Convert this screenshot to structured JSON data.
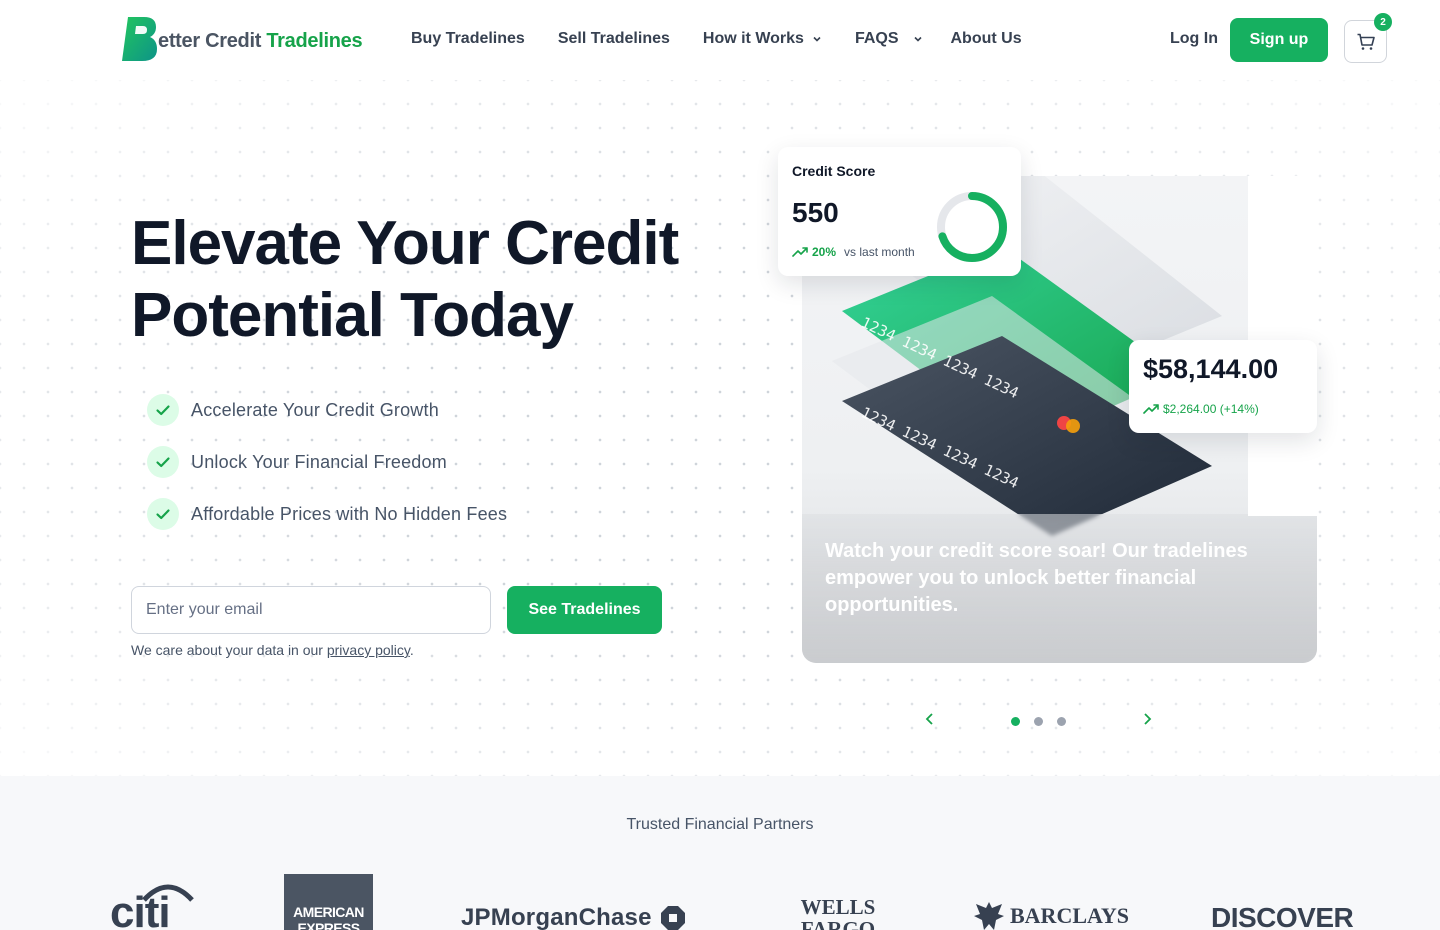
{
  "nav": {
    "brand_part1": "etter Credit",
    "brand_part2": "Tradelines",
    "links": [
      {
        "label": "Buy Tradelines",
        "dropdown": false
      },
      {
        "label": "Sell Tradelines",
        "dropdown": false
      },
      {
        "label": "How it Works",
        "dropdown": true
      },
      {
        "label": "FAQS",
        "dropdown": true
      },
      {
        "label": "About Us",
        "dropdown": false
      }
    ],
    "login_label": "Log In",
    "signup_label": "Sign up",
    "cart_count": "2"
  },
  "hero": {
    "headline_line1": "Elevate Your Credit",
    "headline_line2": "Potential Today",
    "features": [
      "Accelerate Your Credit Growth",
      "Unlock Your Financial Freedom",
      "Affordable Prices with No Hidden Fees"
    ],
    "email_placeholder": "Enter your email",
    "cta_label": "See Tradelines",
    "privacy_prefix": "We care about your data in our ",
    "privacy_link": "privacy policy",
    "privacy_suffix": "."
  },
  "illustration": {
    "score_title": "Credit Score",
    "score_value": "550",
    "score_change": "20%",
    "score_change_suffix": "vs last month",
    "score_fraction": 0.7,
    "balance_value": "$58,144.00",
    "balance_change": "$2,264.00 (+14%)",
    "card_number": "1234 1234 1234 1234",
    "caption": "Watch your credit score soar! Our tradelines empower you to unlock better financial opportunities.",
    "carousel_active": 0,
    "carousel_count": 3
  },
  "partners": {
    "title": "Trusted Financial Partners",
    "logos": [
      "citi",
      "AMERICAN EXPRESS",
      "JPMorganChase",
      "WELLS FARGO",
      "BARCLAYS",
      "DISCOVER"
    ]
  },
  "colors": {
    "brand_green": "#16b060",
    "text_dark": "#101828",
    "text_muted": "#475467"
  }
}
